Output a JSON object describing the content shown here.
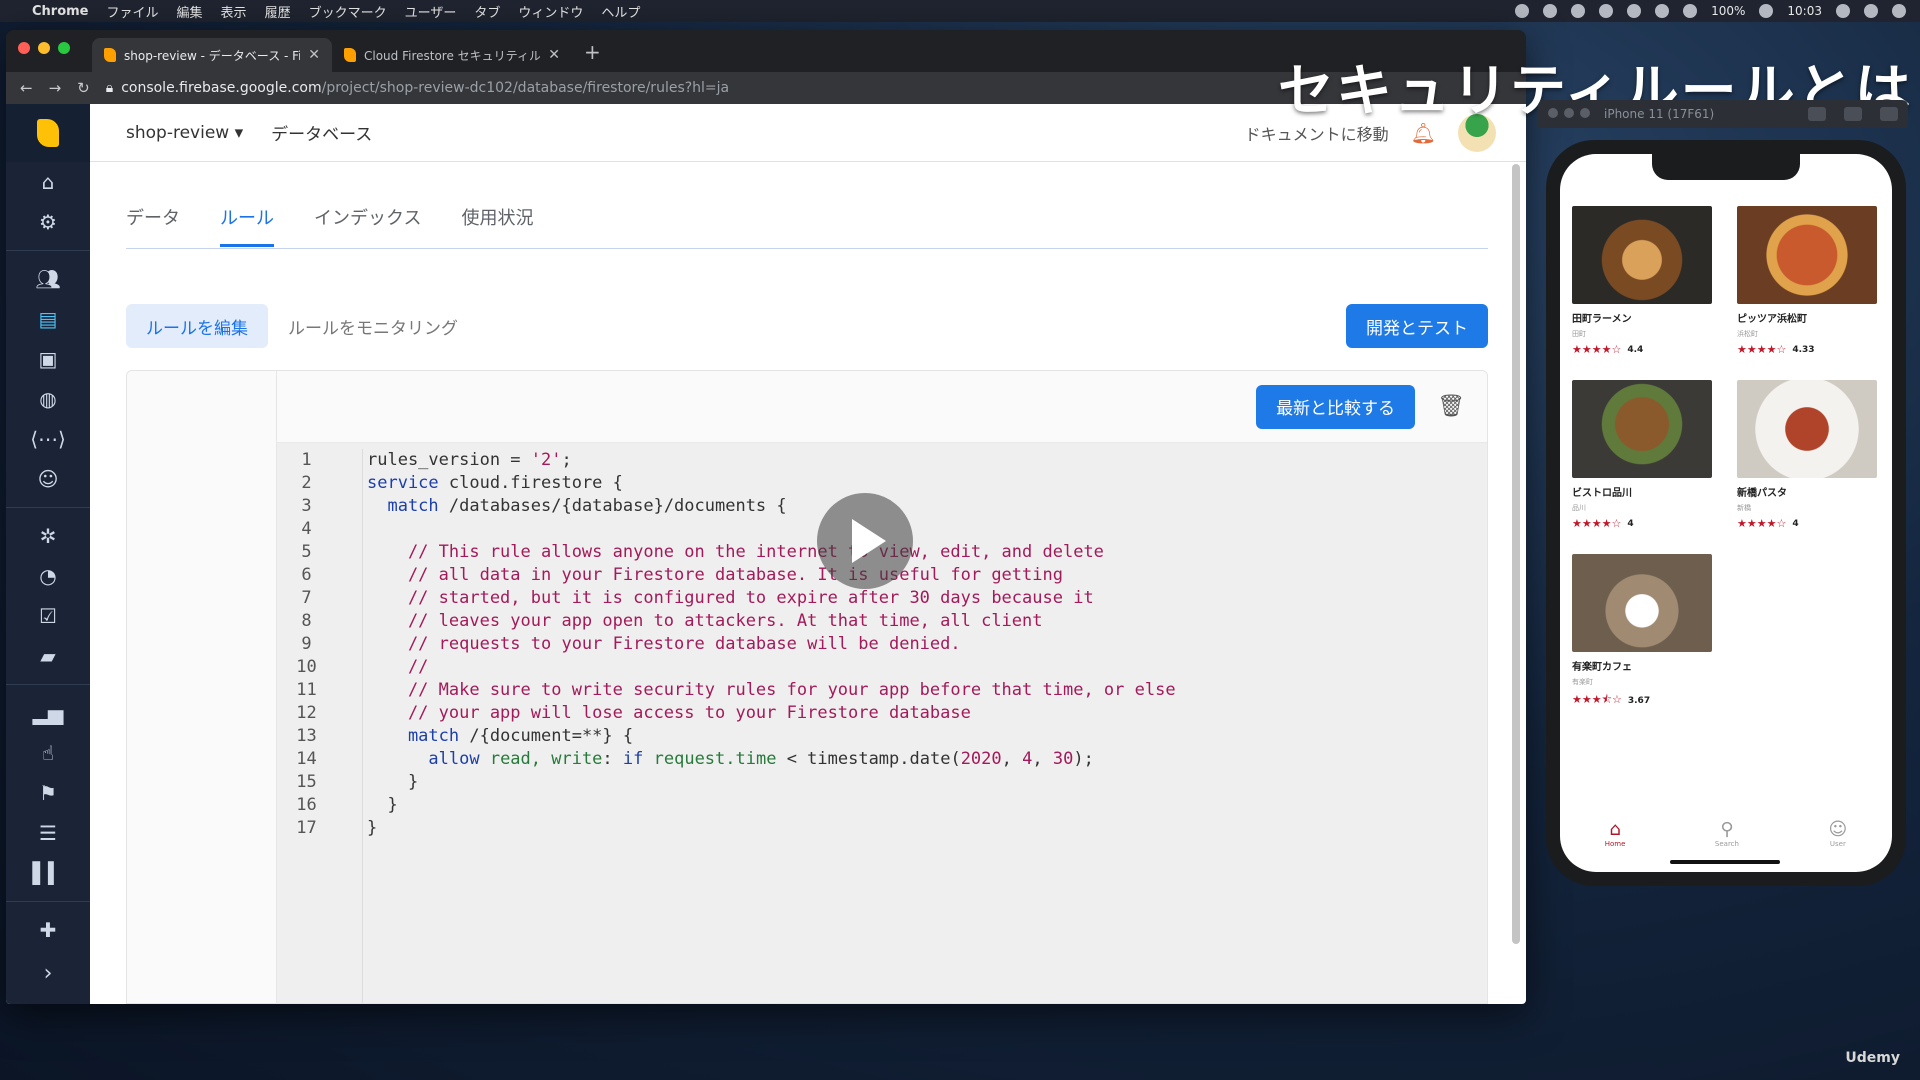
{
  "menubar": {
    "app": "Chrome",
    "items": [
      "ファイル",
      "編集",
      "表示",
      "履歴",
      "ブックマーク",
      "ユーザー",
      "タブ",
      "ウィンドウ",
      "ヘルプ"
    ],
    "battery": "100%",
    "time": "10:03"
  },
  "browser": {
    "tabs": [
      {
        "title": "shop-review - データベース - Fi"
      },
      {
        "title": "Cloud Firestore セキュリティル"
      }
    ],
    "url_host": "console.firebase.google.com",
    "url_path": "/project/shop-review-dc102/database/firestore/rules?hl=ja"
  },
  "firebase": {
    "project": "shop-review",
    "breadcrumb": "データベース",
    "docs_link": "ドキュメントに移動",
    "tabs": [
      "データ",
      "ルール",
      "インデックス",
      "使用状況"
    ],
    "subnav": {
      "edit": "ルールを編集",
      "monitor": "ルールをモニタリング",
      "dev_test": "開発とテスト"
    },
    "compare_button": "最新と比較する"
  },
  "code": {
    "line_numbers": [
      "1",
      "2",
      "3",
      "4",
      "5",
      "6",
      "7",
      "8",
      "9",
      "10",
      "11",
      "12",
      "13",
      "14",
      "15",
      "16",
      "17"
    ]
  },
  "overlay_title": "セキュリティルールとは",
  "simulator": {
    "title": "iPhone 11 (17F61)",
    "shops": [
      {
        "name": "田町ラーメン",
        "area": "田町",
        "rating": "4.4",
        "stars": "★★★★☆"
      },
      {
        "name": "ピッツア浜松町",
        "area": "浜松町",
        "rating": "4.33",
        "stars": "★★★★☆"
      },
      {
        "name": "ビストロ品川",
        "area": "品川",
        "rating": "4",
        "stars": "★★★★☆"
      },
      {
        "name": "新橋パスタ",
        "area": "新橋",
        "rating": "4",
        "stars": "★★★★☆"
      },
      {
        "name": "有楽町カフェ",
        "area": "有楽町",
        "rating": "3.67",
        "stars": "★★★⯪☆"
      }
    ],
    "nav": [
      "Home",
      "Search",
      "User"
    ]
  },
  "watermark": "Udemy"
}
